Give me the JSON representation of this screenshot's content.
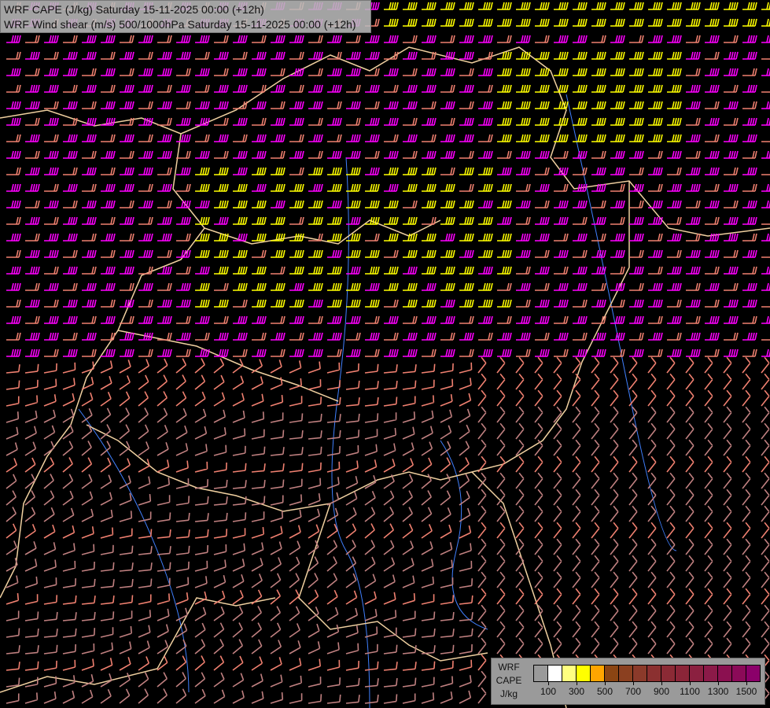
{
  "title": {
    "line1": "WRF CAPE (J/kg) Saturday 15-11-2025 00:00 (+12h)",
    "line2": "WRF Wind shear (m/s) 500/1000hPa Saturday 15-11-2025 00:00 (+12h)"
  },
  "legend": {
    "name_lines": [
      "WRF",
      "CAPE",
      "J/kg"
    ],
    "colors": [
      "#9a9a9a",
      "#ffffff",
      "#ffff80",
      "#ffff00",
      "#ffa500",
      "#8b4513",
      "#8b4020",
      "#8b3a2a",
      "#8b3030",
      "#8b2a35",
      "#8b2538",
      "#8b2040",
      "#8b1a48",
      "#8b1050",
      "#8b0a58",
      "#8b006a"
    ],
    "labels": [
      "100",
      "300",
      "500",
      "700",
      "900",
      "1100",
      "1300",
      "1500"
    ]
  },
  "colors": {
    "barb_strong": "#ffff00",
    "barb_high": "#ff00ff",
    "barb_mid": "#f08070",
    "barb_low": "#c08080",
    "border": "#f0d0a0",
    "river": "#4080ff"
  }
}
